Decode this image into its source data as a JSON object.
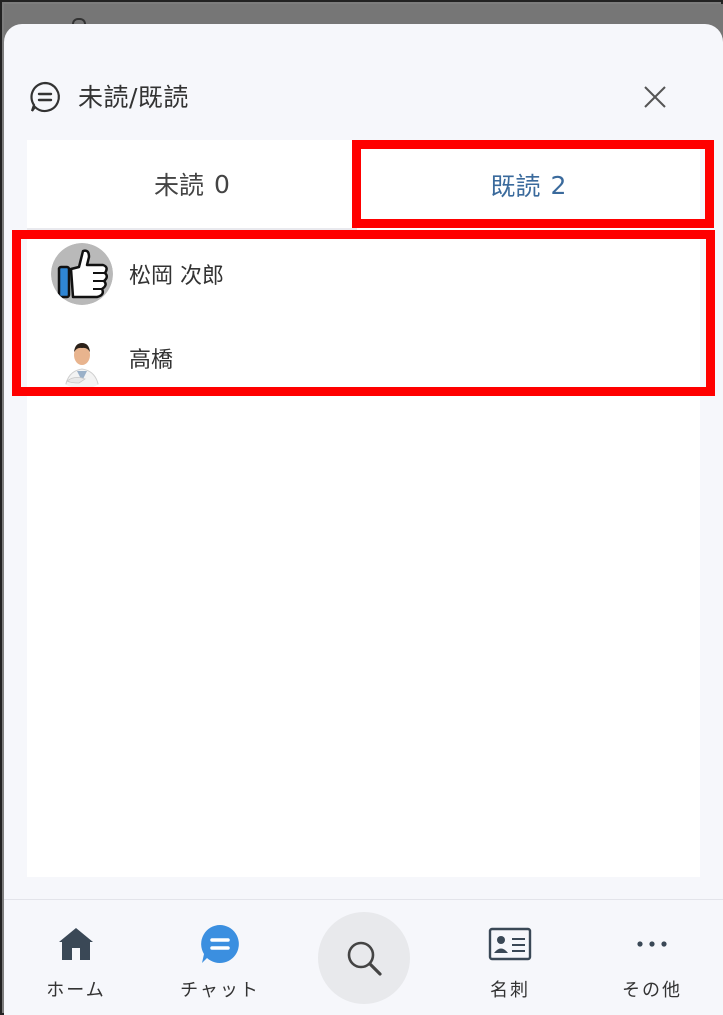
{
  "dialog": {
    "title": "未読/既読"
  },
  "tabs": [
    {
      "label": "未読",
      "count": "0"
    },
    {
      "label": "既読",
      "count": "2"
    }
  ],
  "readers": [
    {
      "name": "松岡 次郎",
      "avatar": "thumbs-up-avatar"
    },
    {
      "name": "高橋",
      "avatar": "person-photo-avatar"
    }
  ],
  "bottom_nav": {
    "home": "ホーム",
    "chat": "チャット",
    "card": "名刺",
    "other": "その他"
  },
  "colors": {
    "active_tab": "#3a6a9c",
    "highlight": "#ff0000",
    "chat_accent": "#3b8fe0",
    "home_icon": "#3a4856"
  }
}
